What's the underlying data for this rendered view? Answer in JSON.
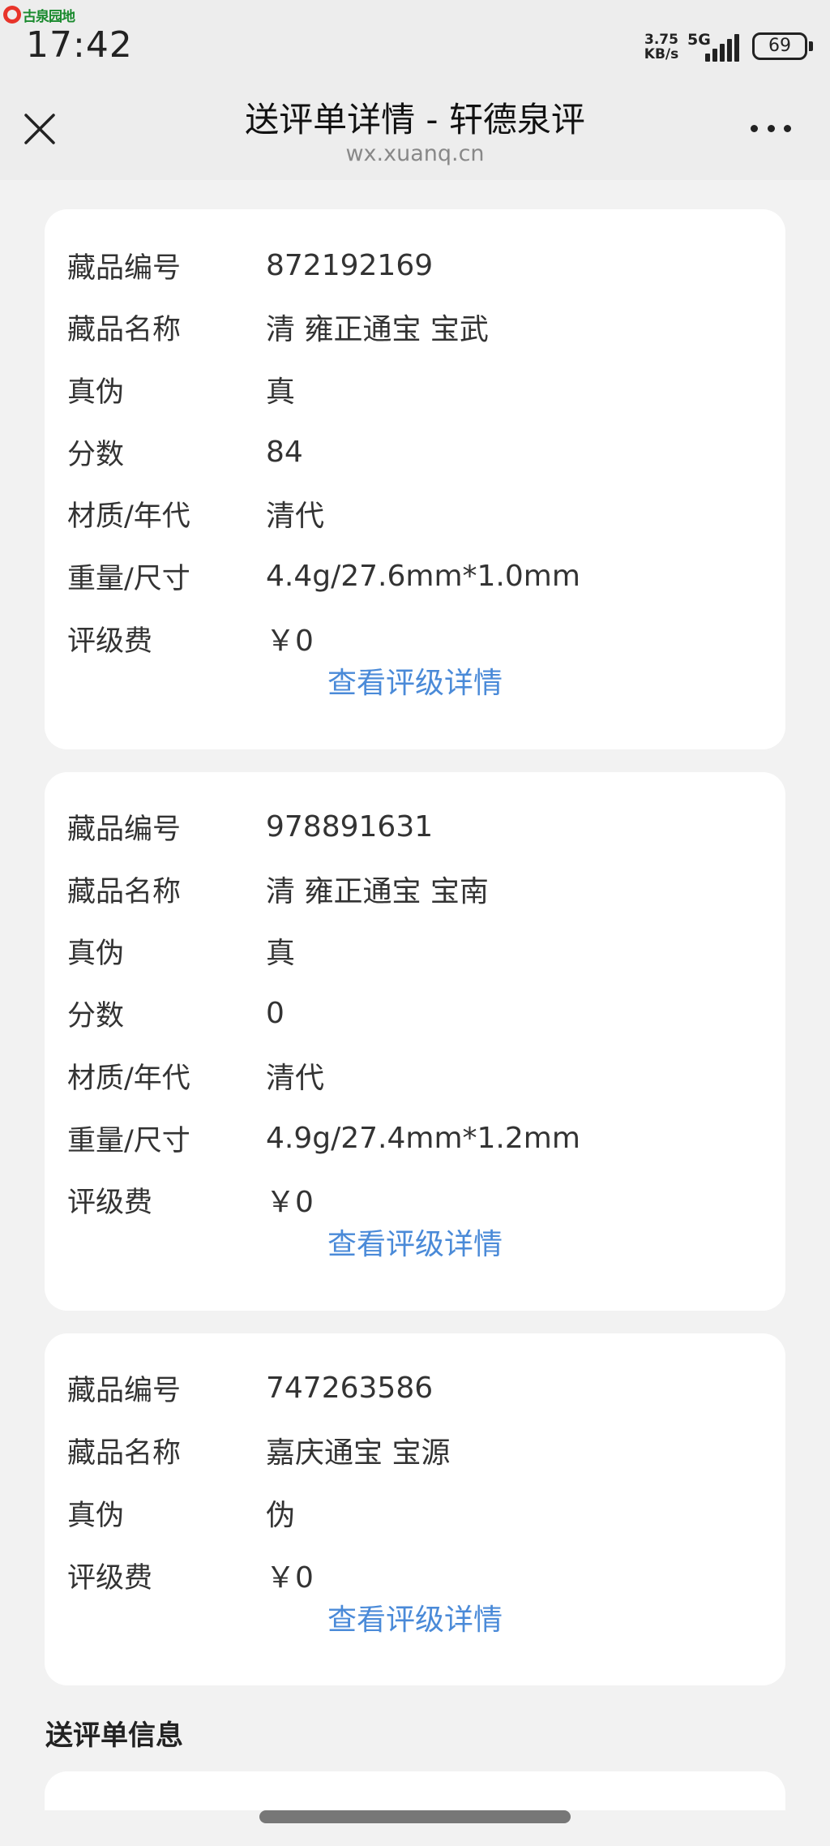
{
  "status_bar": {
    "watermark": "古泉园地",
    "time": "17:42",
    "net_speed_value": "3.75",
    "net_speed_unit": "KB/s",
    "network_type": "5G",
    "battery_level": "69"
  },
  "nav": {
    "title": "送评单详情 - 轩德泉评",
    "subtitle": "wx.xuanq.cn"
  },
  "items": [
    {
      "rows": [
        {
          "label": "藏品编号",
          "value": "872192169"
        },
        {
          "label": "藏品名称",
          "value": "清 雍正通宝 宝武"
        },
        {
          "label": "真伪",
          "value": "真"
        },
        {
          "label": "分数",
          "value": "84"
        },
        {
          "label": "材质/年代",
          "value": "清代"
        },
        {
          "label": "重量/尺寸",
          "value": "4.4g/27.6mm*1.0mm"
        },
        {
          "label": "评级费",
          "value": "￥0"
        }
      ],
      "link": "查看评级详情"
    },
    {
      "rows": [
        {
          "label": "藏品编号",
          "value": "978891631"
        },
        {
          "label": "藏品名称",
          "value": "清 雍正通宝 宝南"
        },
        {
          "label": "真伪",
          "value": "真"
        },
        {
          "label": "分数",
          "value": "0"
        },
        {
          "label": "材质/年代",
          "value": "清代"
        },
        {
          "label": "重量/尺寸",
          "value": "4.9g/27.4mm*1.2mm"
        },
        {
          "label": "评级费",
          "value": "￥0"
        }
      ],
      "link": "查看评级详情"
    },
    {
      "rows": [
        {
          "label": "藏品编号",
          "value": "747263586"
        },
        {
          "label": "藏品名称",
          "value": "嘉庆通宝 宝源"
        },
        {
          "label": "真伪",
          "value": "伪"
        },
        {
          "label": "评级费",
          "value": "￥0"
        }
      ],
      "link": "查看评级详情"
    }
  ],
  "section_title": "送评单信息",
  "colors": {
    "link": "#4a8ad8",
    "background": "#f2f2f2",
    "card": "#ffffff"
  },
  "icons": {
    "close": "close-icon",
    "more": "more-icon",
    "signal": "signal-icon",
    "battery": "battery-icon"
  }
}
